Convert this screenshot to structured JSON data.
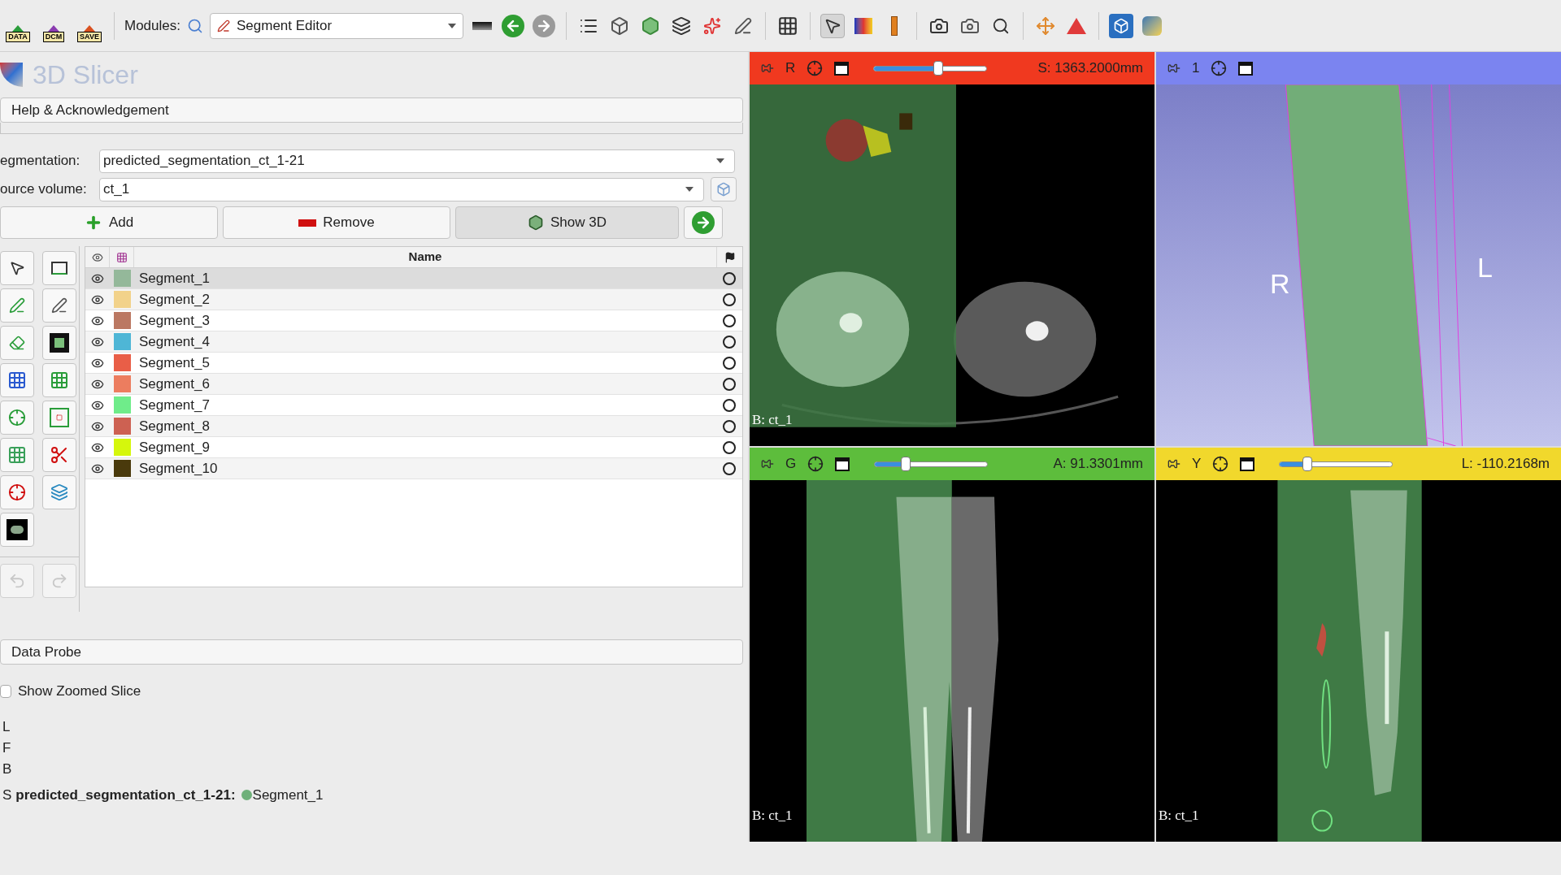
{
  "toolbar": {
    "load_buttons": [
      "DATA",
      "DCM",
      "SAVE"
    ],
    "modules_label": "Modules:",
    "module_select": "Segment Editor"
  },
  "app_title": "3D Slicer",
  "help_section": "Help & Acknowledgement",
  "segmentation": {
    "label": "egmentation:",
    "value": "predicted_segmentation_ct_1-21"
  },
  "source_volume": {
    "label": "ource volume:",
    "value": "ct_1"
  },
  "actions": [
    {
      "kind": "add",
      "label": "Add"
    },
    {
      "kind": "remove",
      "label": "Remove"
    },
    {
      "kind": "show3d",
      "label": "Show 3D"
    }
  ],
  "table": {
    "columns": [
      "Name"
    ],
    "segments": [
      {
        "name": "Segment_1",
        "color": "#94b89a",
        "selected": true
      },
      {
        "name": "Segment_2",
        "color": "#f2d28a",
        "selected": false
      },
      {
        "name": "Segment_3",
        "color": "#bb7862",
        "selected": false
      },
      {
        "name": "Segment_4",
        "color": "#4eb6d6",
        "selected": false
      },
      {
        "name": "Segment_5",
        "color": "#e95e47",
        "selected": false
      },
      {
        "name": "Segment_6",
        "color": "#ec7d5f",
        "selected": false
      },
      {
        "name": "Segment_7",
        "color": "#6fec8a",
        "selected": false
      },
      {
        "name": "Segment_8",
        "color": "#cd6152",
        "selected": false
      },
      {
        "name": "Segment_9",
        "color": "#d5f70c",
        "selected": false
      },
      {
        "name": "Segment_10",
        "color": "#4a3a0c",
        "selected": false
      }
    ]
  },
  "data_probe": {
    "title": "Data Probe",
    "show_zoomed_slice": {
      "label": "Show Zoomed Slice",
      "checked": false
    },
    "lines": [
      "L",
      "F",
      "B"
    ],
    "segment_line": {
      "prefix": "S",
      "segmentation": "predicted_segmentation_ct_1-21:",
      "color": "#6fb07a",
      "segment": "Segment_1"
    }
  },
  "views": [
    {
      "kind": "axial",
      "color": "#f0391f",
      "label": "R",
      "level": 0.57,
      "offset": "S: 1363.2000mm",
      "background": "B: ct_1"
    },
    {
      "kind": "volume",
      "color": "#7b84f0",
      "label": "1",
      "orientation_labels": [
        "R",
        "L"
      ]
    },
    {
      "kind": "coronal",
      "color": "#5dbd3c",
      "label": "G",
      "level": 0.28,
      "offset": "A: 91.3301mm",
      "background": "B: ct_1"
    },
    {
      "kind": "sagittal",
      "color": "#f1d82c",
      "label": "Y",
      "level": 0.25,
      "offset": "L: -110.2168m",
      "background": "B: ct_1"
    }
  ]
}
